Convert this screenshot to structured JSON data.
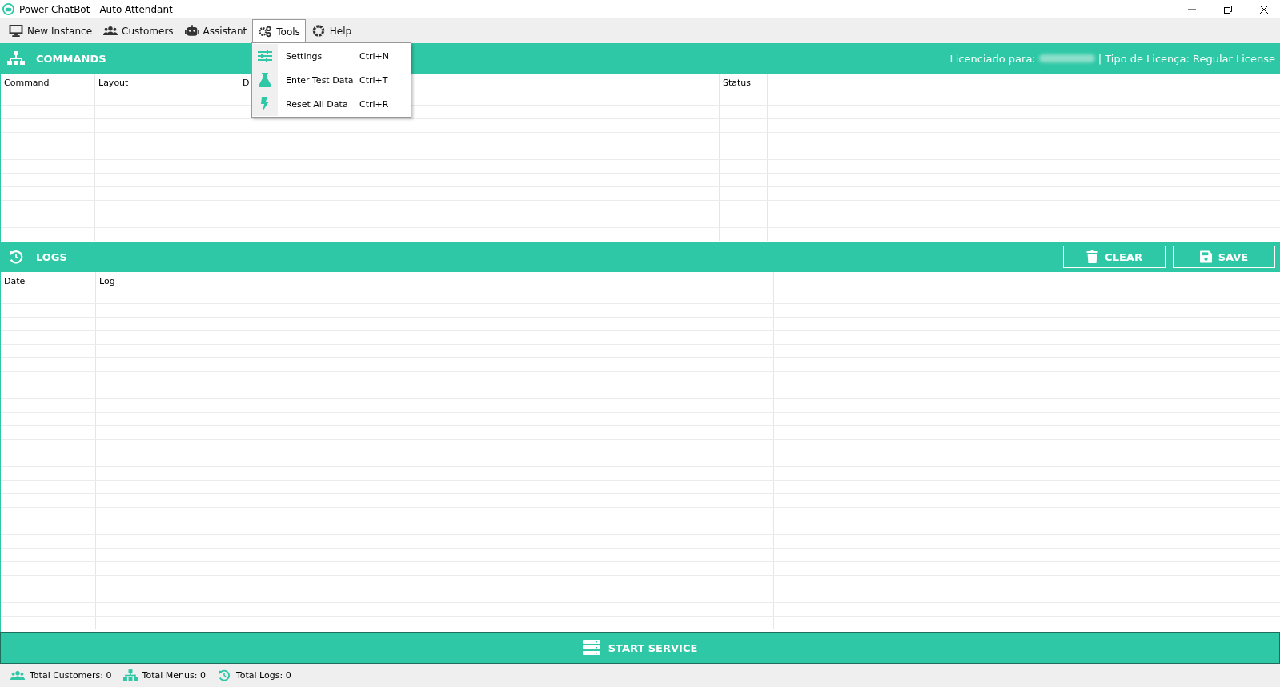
{
  "window": {
    "title": "Power ChatBot - Auto Attendant"
  },
  "menu": [
    {
      "label": "New Instance",
      "selected": false
    },
    {
      "label": "Customers",
      "selected": false
    },
    {
      "label": "Assistant",
      "selected": false
    },
    {
      "label": "Tools",
      "selected": true
    },
    {
      "label": "Help",
      "selected": false
    }
  ],
  "tools_dropdown": [
    {
      "label": "Settings",
      "shortcut": "Ctrl+N"
    },
    {
      "label": "Enter Test Data",
      "shortcut": "Ctrl+T"
    },
    {
      "label": "Reset All Data",
      "shortcut": "Ctrl+R"
    }
  ],
  "commands": {
    "title": "COMMANDS",
    "license_label": "Licenciado para:",
    "license_type": "| Tipo de Licença: Regular License",
    "columns": [
      "Command",
      "Layout",
      "D",
      "Status"
    ]
  },
  "logs": {
    "title": "LOGS",
    "buttons": [
      "CLEAR",
      "SAVE"
    ],
    "columns": [
      "Date",
      "Log"
    ]
  },
  "start_button": "START SERVICE",
  "status_bar": [
    "Total Customers: 0",
    "Total Menus: 0",
    "Total Logs: 0"
  ]
}
